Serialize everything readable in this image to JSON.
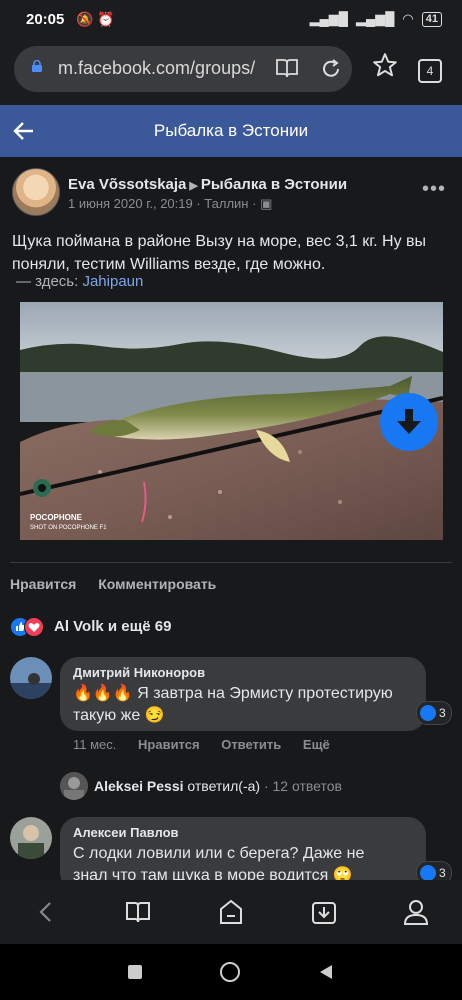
{
  "status": {
    "time": "20:05",
    "battery": "41"
  },
  "browser": {
    "url": "m.facebook.com/groups/",
    "tabs_count": "4"
  },
  "header": {
    "title": "Рыбалка в Эстонии"
  },
  "post": {
    "author": "Eva Võssotskaja",
    "group": "Рыбалка в Эстонии",
    "meta": "1 июня 2020 г., 20:19 · Таллин ·",
    "text": "Щука поймана в районе Вызу на море, вес 3,1 кг. Ну вы поняли, тестим Williams везде, где можно.",
    "location_prefix": "— здесь:",
    "location_link": "Jahipaun",
    "photo_watermark_1": "POCOPHONE",
    "photo_watermark_2": "SHOT ON POCOPHONE F1",
    "like_label": "Нравится",
    "comment_label": "Комментировать",
    "reactions_text": "Al Volk и ещё 69"
  },
  "comments": [
    {
      "name": "Дмитрий Никоноров",
      "emoji": "🔥🔥🔥",
      "text_line1": "Я завтра на Эрмисту протестирую",
      "text_line2": "такую же 😏",
      "reactions": "3",
      "time": "11 мес.",
      "like": "Нравится",
      "reply": "Ответить",
      "more": "Ещё"
    },
    {
      "name": "Алексеи Павлов",
      "text_line1": "С лодки ловили или с берега? Даже не",
      "text_line2": "знал что там щука в море водится 🙄",
      "reactions": "3"
    }
  ],
  "reply_thread": {
    "name": "Aleksei Pessi",
    "action": "ответил(-а)",
    "count": "· 12 ответов"
  },
  "colors": {
    "fb_header": "#3b5998",
    "background": "#18191a",
    "bubble": "#3a3b3c",
    "accent": "#1877f2"
  }
}
